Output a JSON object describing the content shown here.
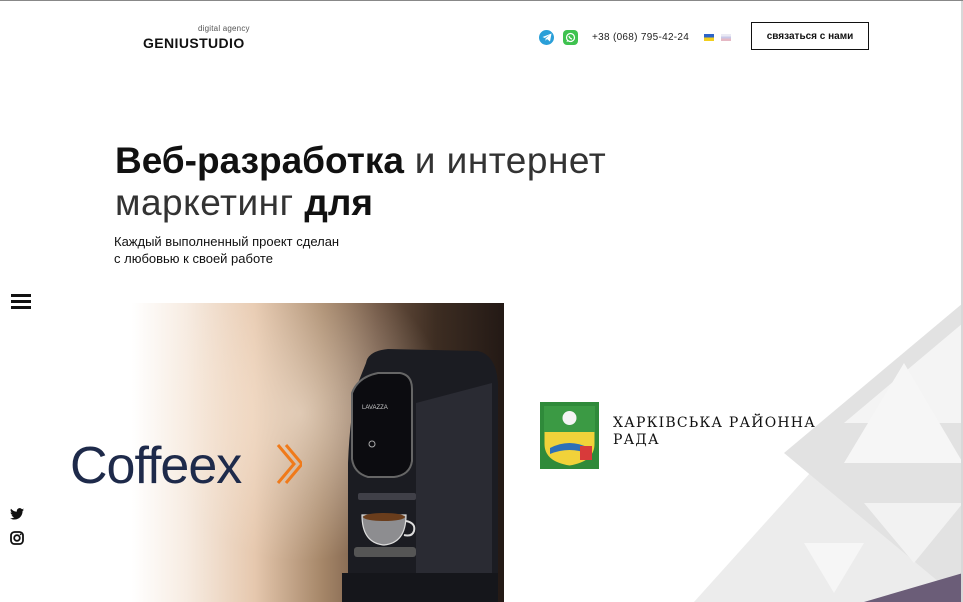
{
  "header": {
    "logo_tag": "digital agency",
    "logo_name": "GENIUSTUDIO",
    "phone": "+38 (068) 795-42-24",
    "contact_label": "связаться с нами",
    "social": [
      "telegram-icon",
      "whatsapp-icon"
    ],
    "languages": [
      "ua-flag",
      "ru-flag"
    ]
  },
  "hero": {
    "title_part1": "Веб-разработка",
    "title_part2": " и интернет",
    "title_part3": "маркетинг ",
    "title_part4": "для",
    "subtitle_line1": "Каждый выполненный проект сделан",
    "subtitle_line2": "с любовью к своей работе"
  },
  "portfolio": [
    {
      "brand": "Coffeex"
    },
    {
      "brand": "ХАРКІВСЬКА РАЙОННА РАДА"
    }
  ],
  "colors": {
    "accent_orange": "#f07a1a",
    "navy": "#1e2a4a",
    "telegram": "#2a9fd8",
    "whatsapp": "#3ec24f"
  }
}
